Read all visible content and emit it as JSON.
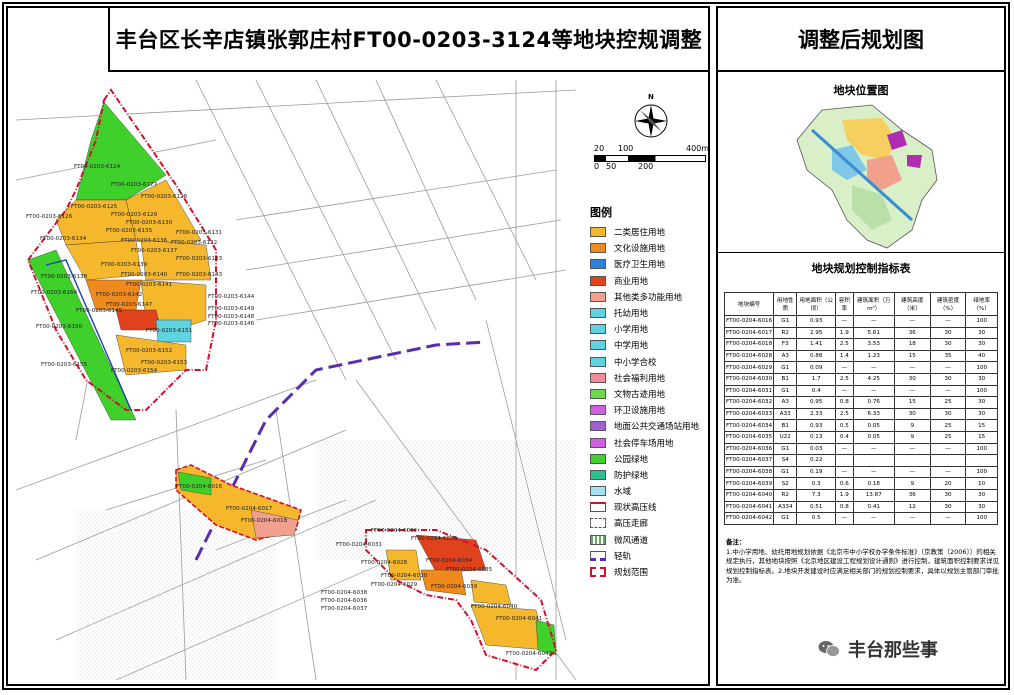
{
  "header": {
    "title": "丰台区长辛店镇张郭庄村FT00-0203-3124等地块控规调整",
    "right_title": "调整后规划图"
  },
  "scale_bar": {
    "labels_top": [
      "20",
      "100",
      "400m"
    ],
    "labels_bottom": [
      "0",
      "50",
      "200"
    ]
  },
  "compass": {
    "label": "N"
  },
  "legend": {
    "title": "图例",
    "items": [
      {
        "label": "二类居住用地",
        "color": "#f5b82c"
      },
      {
        "label": "文化设施用地",
        "color": "#f08a1c"
      },
      {
        "label": "医疗卫生用地",
        "color": "#2f7fd8"
      },
      {
        "label": "商业用地",
        "color": "#e0421c"
      },
      {
        "label": "其他类多功能用地",
        "color": "#f0a08c"
      },
      {
        "label": "托幼用地",
        "color": "#5fd3e0"
      },
      {
        "label": "小学用地",
        "color": "#5fd3e0"
      },
      {
        "label": "中学用地",
        "color": "#5fd3e0"
      },
      {
        "label": "中小学合校",
        "color": "#5fd3e0"
      },
      {
        "label": "社会福利用地",
        "color": "#f08a9c"
      },
      {
        "label": "文物古迹用地",
        "color": "#6fd84c"
      },
      {
        "label": "环卫设施用地",
        "color": "#d060e0"
      },
      {
        "label": "地面公共交通场站用地",
        "color": "#a060d0"
      },
      {
        "label": "社会停车场用地",
        "color": "#d060e0"
      },
      {
        "label": "公园绿地",
        "color": "#3fd02c"
      },
      {
        "label": "防护绿地",
        "color": "#2fbf8f"
      },
      {
        "label": "水域",
        "color": "#a8e0f0"
      },
      {
        "label": "现状高压线",
        "color": "#ffffff"
      },
      {
        "label": "高压走廊",
        "color": "#ffffff"
      },
      {
        "label": "微风通道",
        "color": "#ffffff"
      },
      {
        "label": "轻轨",
        "color": "#ffffff"
      },
      {
        "label": "规划范围",
        "color": "#ffffff"
      }
    ]
  },
  "parcels": [
    "FT00-0203-6124",
    "FT00-0203-6177",
    "FT00-0203-6128",
    "FT00-0203-6125",
    "FT00-0203-6129",
    "FT00-0203-6126",
    "FT00-0203-6130",
    "FT00-0203-6131",
    "FT00-0203-6134",
    "FT00-0203-6135",
    "FT00-0203-6136",
    "FT00-0203-6132",
    "FT00-0203-6137",
    "FT00-0203-6133",
    "FT00-0203-6139",
    "FT00-0203-6140",
    "FT00-0203-6143",
    "FT00-0203-6138",
    "FT00-0203-6141",
    "FT00-0203-6164",
    "FT00-0203-6142",
    "FT00-0203-6144",
    "FT00-0203-6147",
    "FT00-0203-6149",
    "FT00-0203-6148",
    "FT00-0203-6146",
    "FT00-0203-6145",
    "FT00-0203-6150",
    "FT00-0203-6151",
    "FT00-0203-6152",
    "FT00-0203-6153",
    "FT00-0203-6155",
    "FT00-0203-6154",
    "FT00-0204-6016",
    "FT00-0204-6017",
    "FT00-0204-6018",
    "FT00-0204-6032",
    "FT00-0204-6033",
    "FT00-0204-6031",
    "FT00-0204-6034",
    "FT00-0204-6035",
    "FT00-0204-6028",
    "FT00-0204-6030",
    "FT00-0204-6029",
    "FT00-0204-6039",
    "FT00-0204-6038",
    "FT00-0204-6036",
    "FT00-0204-6037",
    "FT00-0204-6040",
    "FT00-0204-6041",
    "FT00-0204-6042"
  ],
  "location_map": {
    "title": "地块位置图"
  },
  "control_table": {
    "title": "地块规划控制指标表",
    "headers": [
      "地块编号",
      "用地性质",
      "用地面积（公顷）",
      "容积率",
      "建筑面积（万m²）",
      "建筑高度（米）",
      "建筑密度（%）",
      "绿地率（%）"
    ],
    "rows": [
      [
        "FT00-0204-6016",
        "G1",
        "0.93",
        "—",
        "—",
        "—",
        "—",
        "100"
      ],
      [
        "FT00-0204-6017",
        "R2",
        "2.95",
        "1.9",
        "5.61",
        "36",
        "30",
        "30"
      ],
      [
        "FT00-0204-6018",
        "F3",
        "1.41",
        "2.5",
        "3.53",
        "18",
        "30",
        "30"
      ],
      [
        "FT00-0204-6028",
        "A3",
        "0.88",
        "1.4",
        "1.23",
        "15",
        "35",
        "40"
      ],
      [
        "FT00-0204-6029",
        "G1",
        "0.09",
        "—",
        "—",
        "—",
        "—",
        "100"
      ],
      [
        "FT00-0204-6030",
        "B1",
        "1.7",
        "2.5",
        "4.25",
        "30",
        "30",
        "30"
      ],
      [
        "FT00-0204-6031",
        "G1",
        "0.4",
        "—",
        "—",
        "—",
        "—",
        "100"
      ],
      [
        "FT00-0204-6032",
        "A3",
        "0.95",
        "0.8",
        "0.76",
        "15",
        "25",
        "30"
      ],
      [
        "FT00-0204-6033",
        "A33",
        "2.33",
        "2.5",
        "6.33",
        "30",
        "30",
        "30"
      ],
      [
        "FT00-0204-6034",
        "B1",
        "0.93",
        "0.5",
        "0.05",
        "9",
        "25",
        "15"
      ],
      [
        "FT00-0204-6035",
        "U22",
        "0.13",
        "0.4",
        "0.05",
        "9",
        "25",
        "15"
      ],
      [
        "FT00-0204-6036",
        "G1",
        "0.03",
        "—",
        "—",
        "—",
        "—",
        "100"
      ],
      [
        "FT00-0204-6037",
        "S4",
        "0.22",
        "",
        "",
        "",
        "",
        ""
      ],
      [
        "FT00-0204-6038",
        "G1",
        "0.19",
        "—",
        "—",
        "—",
        "—",
        "100"
      ],
      [
        "FT00-0204-6039",
        "S2",
        "0.3",
        "0.6",
        "0.18",
        "9",
        "20",
        "10"
      ],
      [
        "FT00-0204-6040",
        "R2",
        "7.3",
        "1.9",
        "13.87",
        "36",
        "30",
        "30"
      ],
      [
        "FT00-0204-6041",
        "A334",
        "0.51",
        "0.8",
        "0.41",
        "12",
        "30",
        "30"
      ],
      [
        "FT00-0204-6042",
        "G1",
        "0.5",
        "—",
        "—",
        "—",
        "—",
        "100"
      ]
    ]
  },
  "notes": {
    "title": "备注：",
    "text": "1.中小学用地、幼托用地规划依据《北京市中小学校办学条件标准》（京教策〔2006〕）的相关规定执行，其他地块按照《北京地区建设工程规划设计通则》进行控制，建筑面积控制要求详见规划控制指标表。2.地块开发建设时应满足相关部门的规划控制要求，具体以规划主管部门审批为准。"
  },
  "watermark": {
    "text": "丰台那些事"
  }
}
